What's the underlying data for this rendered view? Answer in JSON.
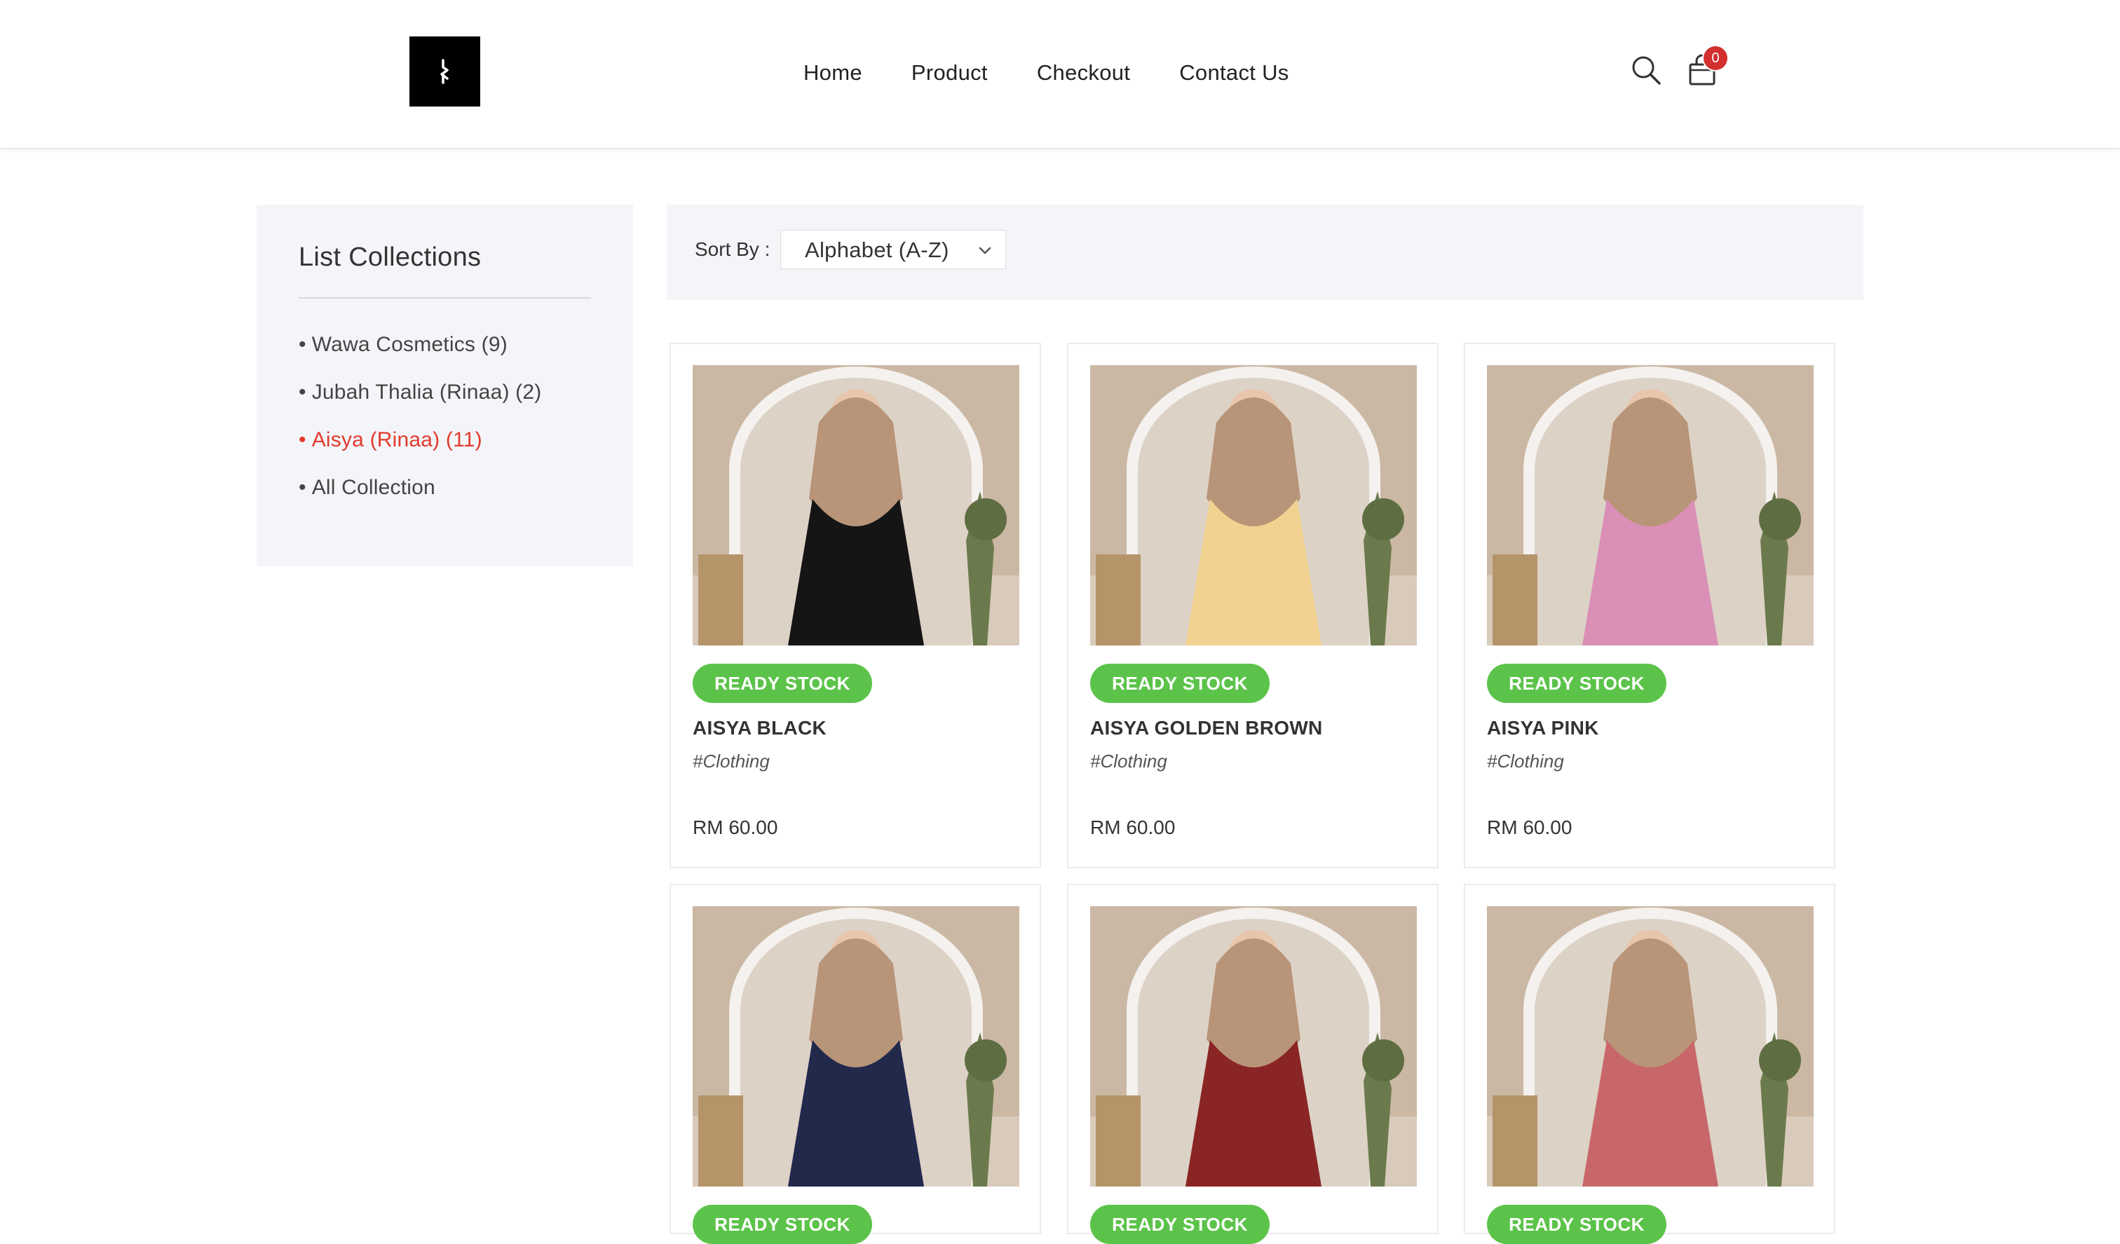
{
  "nav": {
    "items": [
      "Home",
      "Product",
      "Checkout",
      "Contact Us"
    ]
  },
  "cart": {
    "count": "0"
  },
  "sidebar": {
    "title": "List Collections",
    "items": [
      {
        "label": "Wawa Cosmetics (9)",
        "active": false
      },
      {
        "label": "Jubah Thalia (Rinaa) (2)",
        "active": false
      },
      {
        "label": "Aisya (Rinaa) (11)",
        "active": true
      },
      {
        "label": "All Collection",
        "active": false
      }
    ]
  },
  "sort": {
    "label": "Sort By :",
    "value": "Alphabet (A-Z)"
  },
  "products": [
    {
      "badge": "READY STOCK",
      "name": "AISYA BLACK",
      "category": "#Clothing",
      "price": "RM 60.00",
      "color": "#151515"
    },
    {
      "badge": "READY STOCK",
      "name": "AISYA GOLDEN BROWN",
      "category": "#Clothing",
      "price": "RM 60.00",
      "color": "#f2d290"
    },
    {
      "badge": "READY STOCK",
      "name": "AISYA PINK",
      "category": "#Clothing",
      "price": "RM 60.00",
      "color": "#d98fb6"
    },
    {
      "badge": "READY STOCK",
      "name": "",
      "category": "",
      "price": "",
      "color": "#222a4c"
    },
    {
      "badge": "READY STOCK",
      "name": "",
      "category": "",
      "price": "",
      "color": "#8a2525"
    },
    {
      "badge": "READY STOCK",
      "name": "",
      "category": "",
      "price": "",
      "color": "#c8676a"
    }
  ]
}
